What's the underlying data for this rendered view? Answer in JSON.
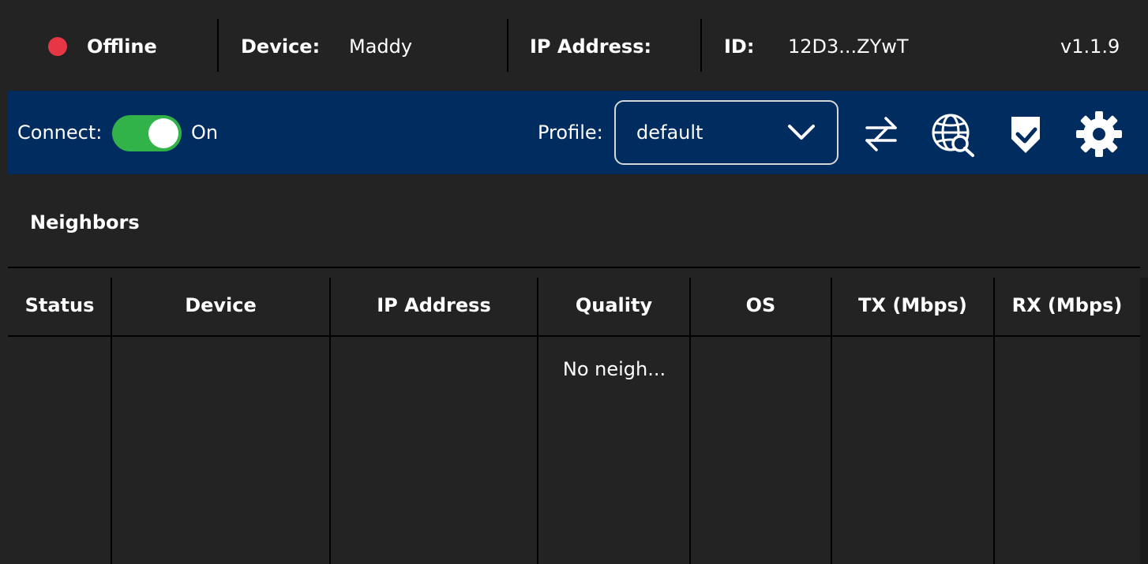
{
  "status": {
    "state": "Offline",
    "state_color": "#e83744",
    "device_label": "Device:",
    "device_value": "Maddy",
    "ip_label": "IP Address:",
    "ip_value": "",
    "id_label": "ID:",
    "id_value": "12D3...ZYwT",
    "version": "v1.1.9"
  },
  "toolbar": {
    "connect_label": "Connect:",
    "connect_state": "On",
    "connect_enabled": true,
    "toggle_color": "#32b34a",
    "background_color": "#002c60",
    "profile_label": "Profile:",
    "profile_value": "default",
    "icons": [
      "transfer-arrows-icon",
      "globe-search-icon",
      "shield-check-icon",
      "gear-icon"
    ]
  },
  "neighbors": {
    "title": "Neighbors",
    "columns": [
      "Status",
      "Device",
      "IP Address",
      "Quality",
      "OS",
      "TX (Mbps)",
      "RX (Mbps)"
    ],
    "rows": [],
    "empty_message": "No neigh..."
  }
}
